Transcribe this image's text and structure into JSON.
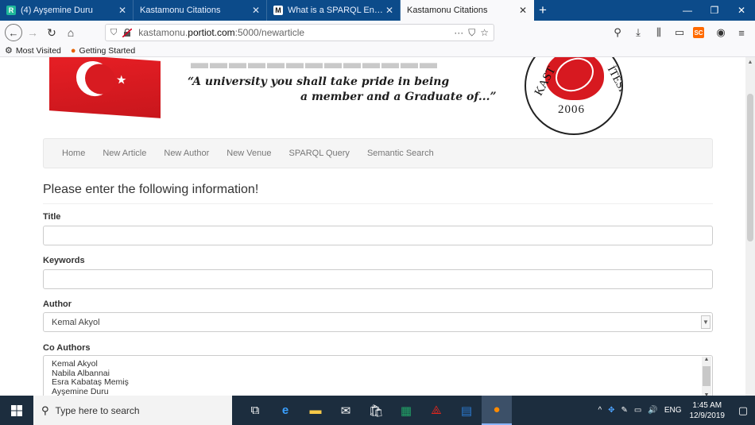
{
  "browser": {
    "tabs": [
      {
        "label": "(4) Ayşemine Duru",
        "favicon": "R",
        "favicon_color": "#1fb89a",
        "active": false
      },
      {
        "label": "Kastamonu Citations",
        "favicon": "",
        "favicon_color": "",
        "active": false
      },
      {
        "label": "What is a SPARQL Endpoint, an",
        "favicon": "M",
        "favicon_color": "#ffffff",
        "active": false
      },
      {
        "label": "Kastamonu Citations",
        "favicon": "",
        "favicon_color": "",
        "active": true
      }
    ],
    "url_prefix": "kastamonu.",
    "url_host": "portiot.com",
    "url_path": ":5000/newarticle",
    "bookmarks": [
      "Most Visited",
      "Getting Started"
    ],
    "sc_label": "SC"
  },
  "banner": {
    "slogan_line1": "“A university you shall take pride in being",
    "slogan_line2": "a member and a Graduate of...”",
    "seal_text_left": "KAST",
    "seal_text_right": "İTESİ",
    "seal_year": "2006"
  },
  "nav": {
    "items": [
      "Home",
      "New Article",
      "New Author",
      "New Venue",
      "SPARQL Query",
      "Semantic Search"
    ]
  },
  "form": {
    "heading": "Please enter the following information!",
    "title_label": "Title",
    "keywords_label": "Keywords",
    "author_label": "Author",
    "author_selected": "Kemal Akyol",
    "coauthors_label": "Co Authors",
    "coauthors_options": [
      "Kemal Akyol",
      "Nabila Albannai",
      "Esra Kabataş Memiş",
      "Ayşemine Duru"
    ]
  },
  "taskbar": {
    "search_placeholder": "Type here to search",
    "language": "ENG",
    "time": "1:45 AM",
    "date": "12/9/2019"
  },
  "colors": {
    "taskbar_bg": "#1c2d3e",
    "tabbar_bg": "#0c4b8a",
    "flag_red": "#e81f25"
  }
}
